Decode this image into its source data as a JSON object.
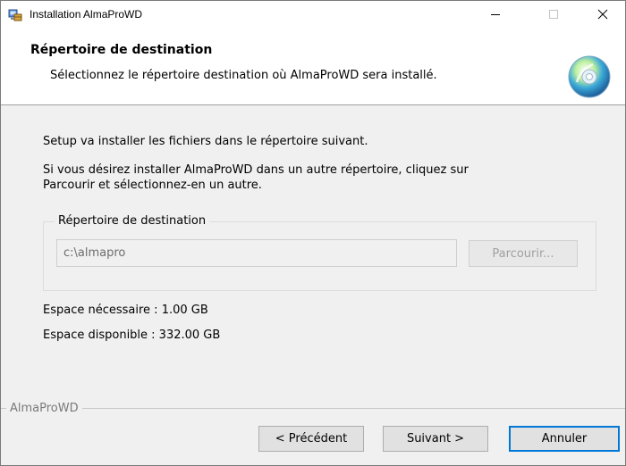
{
  "window": {
    "title": "Installation AlmaProWD"
  },
  "header": {
    "title": "Répertoire de destination",
    "subtitle": "Sélectionnez le répertoire destination où AlmaProWD sera installé."
  },
  "content": {
    "line1": "Setup va installer les fichiers dans le répertoire suivant.",
    "line2": "Si vous désirez installer AlmaProWD dans un autre répertoire, cliquez sur",
    "line3": "Parcourir et sélectionnez-en un autre.",
    "group_label": "Répertoire de destination",
    "directory_value": "c:\\almapro",
    "browse_label": "Parcourir...",
    "space_required": "Espace nécessaire : 1.00 GB",
    "space_available": "Espace disponible : 332.00 GB"
  },
  "footer": {
    "brand": "AlmaProWD",
    "back_label": "< Précédent",
    "next_label": "Suivant >",
    "cancel_label": "Annuler"
  },
  "colors": {
    "focus_border": "#0078d7",
    "dialog_background": "#f0f0f0"
  },
  "icons": {
    "app": "installer-icon",
    "header": "cd-disc-icon"
  }
}
